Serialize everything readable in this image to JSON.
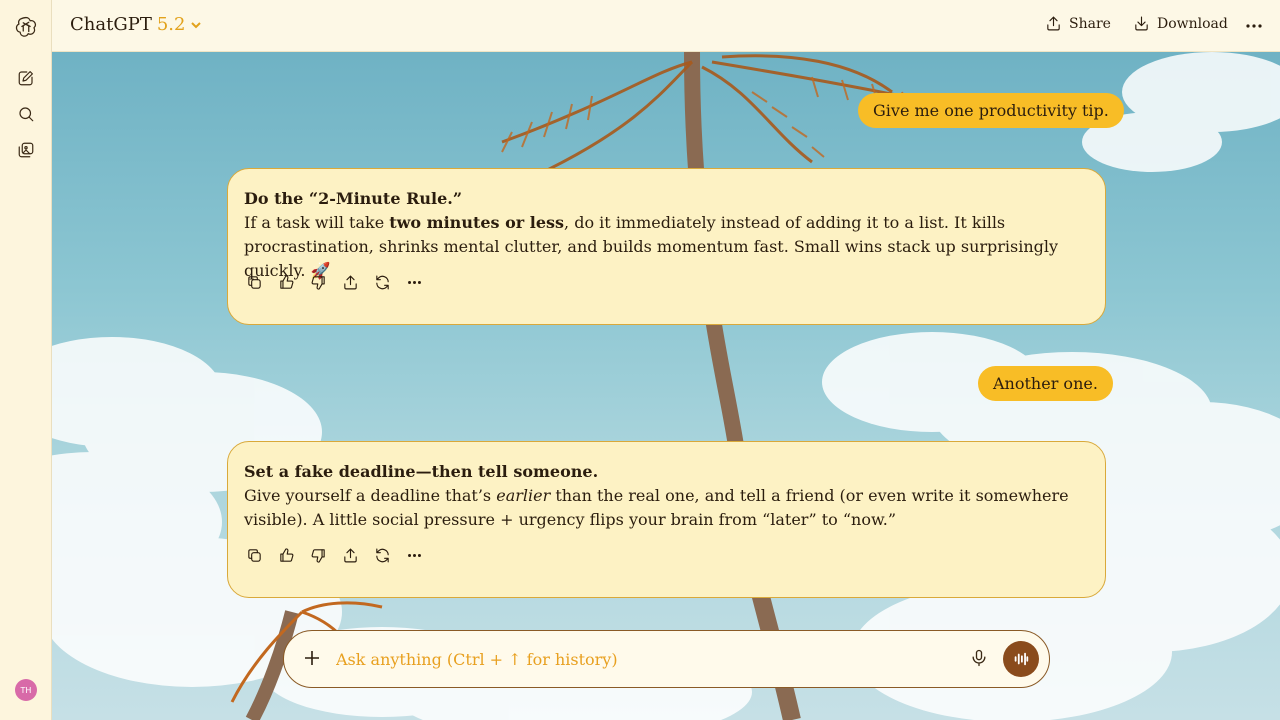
{
  "header": {
    "model_name": "ChatGPT",
    "model_version": "5.2",
    "share_label": "Share",
    "download_label": "Download"
  },
  "sidebar": {
    "avatar_initials": "TH"
  },
  "messages": {
    "user_1": "Give me one productivity tip.",
    "ai_1": {
      "title": "Do the “2-Minute Rule.”",
      "body_before": "If a task will take ",
      "body_bold": "two minutes or less",
      "body_after": ", do it immediately instead of adding it to a list. It kills procrastination, shrinks mental clutter, and builds momentum fast. Small wins stack up surprisingly quickly. 🚀"
    },
    "user_2": "Another one.",
    "ai_2": {
      "title": "Set a fake deadline—then tell someone.",
      "body_before": "Give yourself a deadline that’s ",
      "body_italic": "earlier",
      "body_after": " than the real one, and tell a friend (or even write it somewhere visible). A little social pressure + urgency flips your brain from “later” to “now.”"
    }
  },
  "composer": {
    "placeholder": "Ask anything (Ctrl + ↑ for history)",
    "value": ""
  },
  "colors": {
    "accent": "#f8bd26",
    "version": "#e2a21c",
    "voice_button": "#8a4b1c",
    "avatar": "#d86aa8"
  }
}
